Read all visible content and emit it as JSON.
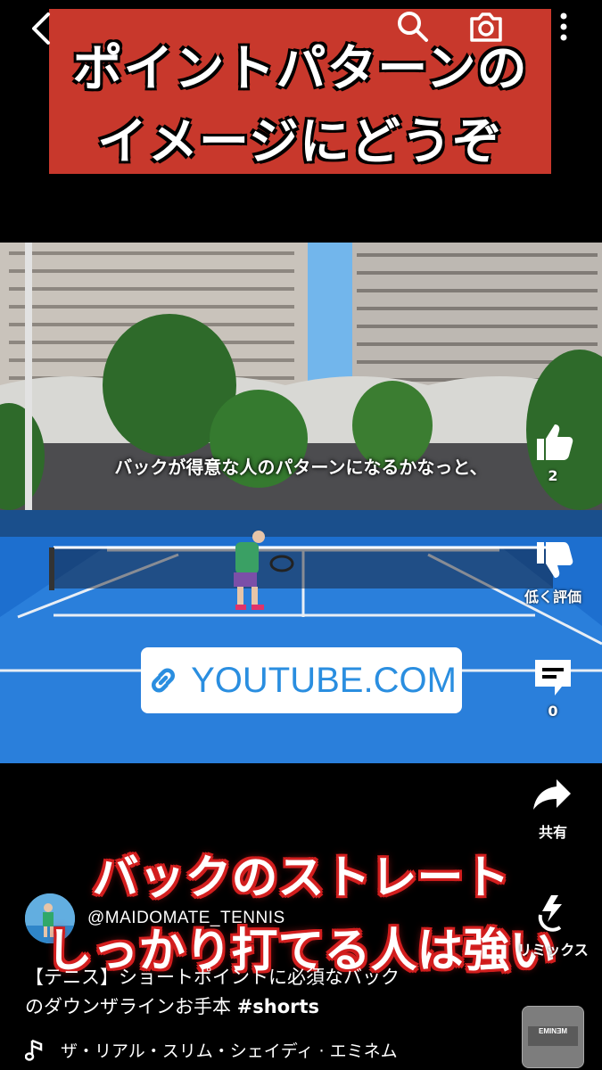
{
  "title_banner": {
    "line1": "ポイントパターンの",
    "line2": "イメージにどうぞ"
  },
  "top_bar": {
    "back_icon": "chevron-left-icon",
    "search_icon": "search-icon",
    "camera_icon": "camera-icon",
    "more_icon": "more-vertical-icon"
  },
  "video": {
    "caption": "バックが得意な人のパターンになるかなっと、",
    "link_chip": "YOUTUBE.COM"
  },
  "actions": {
    "like_count": "2",
    "dislike_label": "低く評価",
    "comment_count": "0",
    "share_label": "共有",
    "remix_label": "リミックス"
  },
  "overlay_captions": {
    "line1": "バックのストレート",
    "line2": "しっかり打てる人は強い"
  },
  "channel": {
    "handle": "@MAIDOMATE_TENNIS"
  },
  "description": {
    "line1": "【テニス】ショートポイントに必須なバック",
    "line2_text": "のダウンザラインお手本 ",
    "hashtag": "#shorts"
  },
  "music": {
    "track": "ザ・リアル・スリム・シェイディ · エミネム",
    "album_text": "EMINƎM"
  },
  "colors": {
    "banner_red": "#c8382c",
    "court_blue": "#1d6fcf",
    "link_blue": "#2a8ee0"
  }
}
